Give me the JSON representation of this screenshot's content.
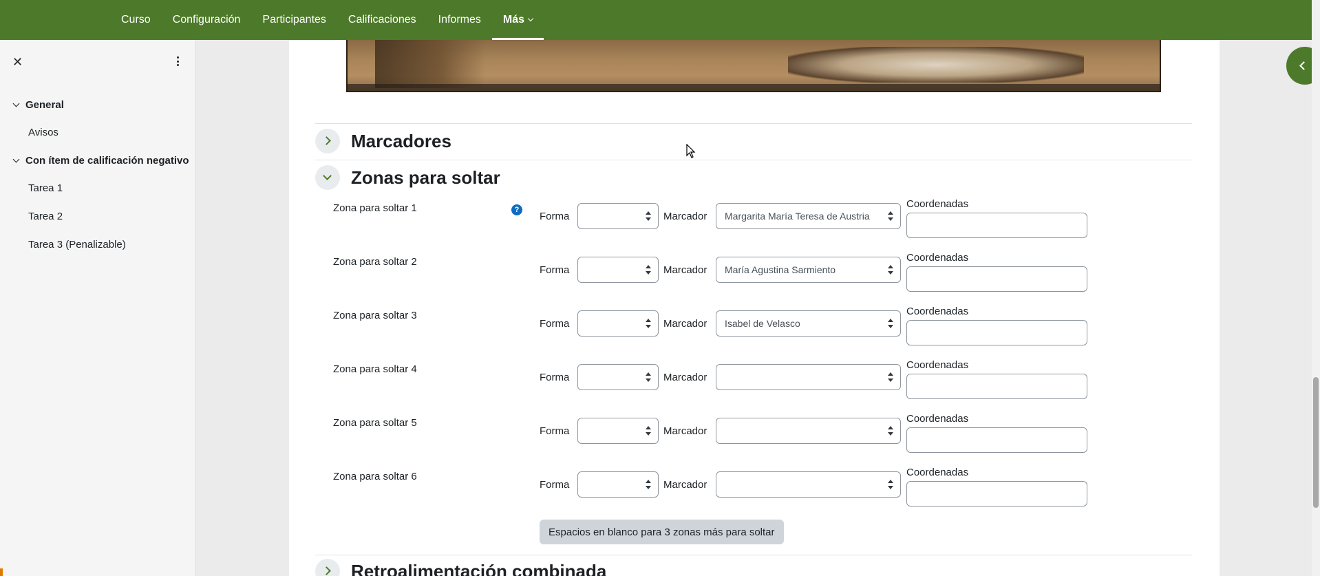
{
  "navbar": {
    "items": [
      {
        "label": "Curso"
      },
      {
        "label": "Configuración"
      },
      {
        "label": "Participantes"
      },
      {
        "label": "Calificaciones"
      },
      {
        "label": "Informes"
      },
      {
        "label": "Más",
        "active": true
      }
    ],
    "color": "#4d7a2a"
  },
  "drawer": {
    "close_glyph": "✕",
    "sections": [
      {
        "label": "General",
        "items": [
          {
            "label": "Avisos"
          }
        ]
      },
      {
        "label": "Con ítem de calificación negativo",
        "items": [
          {
            "label": "Tarea 1"
          },
          {
            "label": "Tarea 2"
          },
          {
            "label": "Tarea 3 (Penalizable)"
          }
        ]
      }
    ]
  },
  "sections": {
    "markers": {
      "title": "Marcadores",
      "expanded": false
    },
    "dropzones": {
      "title": "Zonas para soltar",
      "expanded": true
    },
    "feedback": {
      "title": "Retroalimentación combinada",
      "expanded": false
    }
  },
  "dropzone_labels": {
    "shape": "Forma",
    "marker": "Marcador",
    "coords": "Coordenadas",
    "help": "?"
  },
  "dropzones": [
    {
      "label": "Zona para soltar 1",
      "shape": "",
      "marker": "Margarita María Teresa de Austria",
      "coords": ""
    },
    {
      "label": "Zona para soltar 2",
      "shape": "",
      "marker": "María Agustina Sarmiento",
      "coords": ""
    },
    {
      "label": "Zona para soltar 3",
      "shape": "",
      "marker": "Isabel de Velasco",
      "coords": ""
    },
    {
      "label": "Zona para soltar 4",
      "shape": "",
      "marker": "",
      "coords": ""
    },
    {
      "label": "Zona para soltar 5",
      "shape": "",
      "marker": "",
      "coords": ""
    },
    {
      "label": "Zona para soltar 6",
      "shape": "",
      "marker": "",
      "coords": ""
    }
  ],
  "blanks_button": "Espacios en blanco para 3 zonas más para soltar"
}
